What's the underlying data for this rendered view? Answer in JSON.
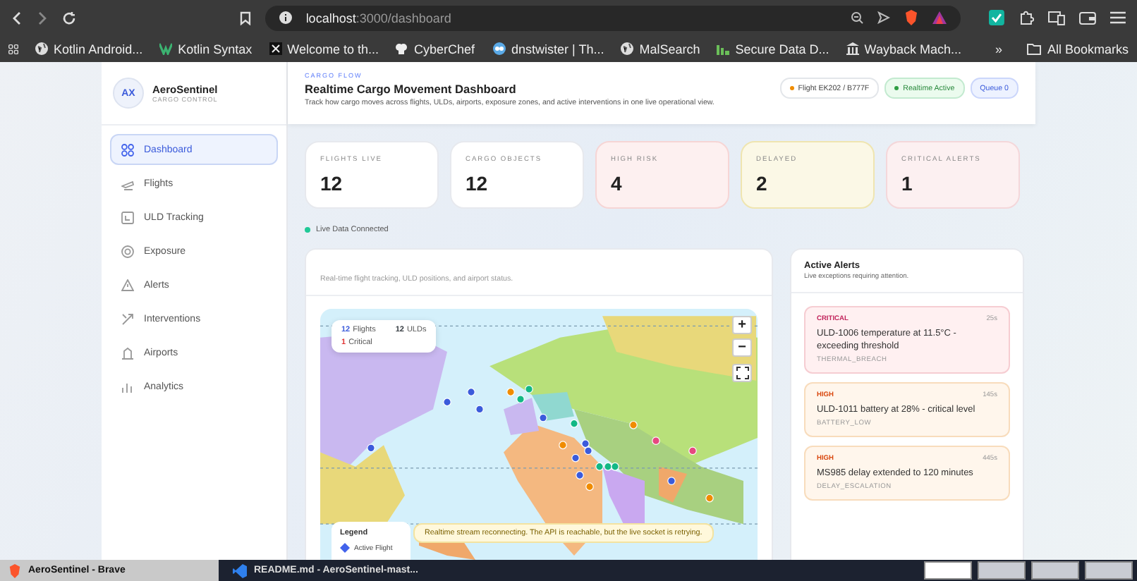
{
  "browser": {
    "url_host": "localhost",
    "url_path": ":3000/dashboard",
    "bookmarks": [
      {
        "label": "Kotlin Android...",
        "kind": "globe"
      },
      {
        "label": "Kotlin Syntax",
        "kind": "k"
      },
      {
        "label": "Welcome to th...",
        "kind": "square"
      },
      {
        "label": "CyberChef",
        "kind": "chef"
      },
      {
        "label": "dnstwister | Th...",
        "kind": "ring"
      },
      {
        "label": "MalSearch",
        "kind": "globe"
      },
      {
        "label": "Secure Data D...",
        "kind": "bars"
      },
      {
        "label": "Wayback Mach...",
        "kind": "building"
      }
    ],
    "overflow": "»",
    "all_bookmarks": "All Bookmarks"
  },
  "sidebar": {
    "avatar": "AX",
    "brand": "AeroSentinel",
    "subtitle": "CARGO CONTROL",
    "items": [
      {
        "label": "Dashboard",
        "selected": true
      },
      {
        "label": "Flights",
        "selected": false
      },
      {
        "label": "ULD Tracking",
        "selected": false
      },
      {
        "label": "Exposure",
        "selected": false
      },
      {
        "label": "Alerts",
        "selected": false
      },
      {
        "label": "Interventions",
        "selected": false
      },
      {
        "label": "Airports",
        "selected": false
      },
      {
        "label": "Analytics",
        "selected": false
      }
    ]
  },
  "header": {
    "eyebrow": "CARGO FLOW",
    "title": "Realtime Cargo Movement Dashboard",
    "description": "Track how cargo moves across flights, ULDs, airports, exposure zones, and active interventions in one live operational view.",
    "pills": [
      {
        "label": "Flight EK202 / B777F",
        "kind": "flight"
      },
      {
        "label": "Realtime Active",
        "kind": "active"
      },
      {
        "label": "Queue 0",
        "kind": "queue"
      }
    ]
  },
  "stats": [
    {
      "label": "FLIGHTS LIVE",
      "value": "12",
      "kind": "plain"
    },
    {
      "label": "CARGO OBJECTS",
      "value": "12",
      "kind": "plain"
    },
    {
      "label": "HIGH RISK",
      "value": "4",
      "kind": "risk"
    },
    {
      "label": "DELAYED",
      "value": "2",
      "kind": "delayed"
    },
    {
      "label": "CRITICAL ALERTS",
      "value": "1",
      "kind": "critical"
    }
  ],
  "connection": "Live Data Connected",
  "map_card": {
    "subtitle": "Real-time flight tracking, ULD positions, and airport status.",
    "counts": [
      {
        "value": "12",
        "label": "Flights",
        "color": "#3b5bdb"
      },
      {
        "value": "12",
        "label": "ULDs",
        "color": "#343a40"
      },
      {
        "value": "1",
        "label": "Critical",
        "color": "#e03131"
      }
    ],
    "zoom_in": "+",
    "zoom_out": "−",
    "legend_title": "Legend",
    "legend_items": [
      "Active Flight"
    ],
    "banner": "Realtime stream reconnecting. The API is reachable, but the live socket is retrying."
  },
  "alerts": {
    "title": "Active Alerts",
    "subtitle": "Live exceptions requiring attention.",
    "items": [
      {
        "severity": "CRITICAL",
        "time": "25s",
        "message": "ULD-1006 temperature at 11.5°C - exceeding threshold",
        "code": "THERMAL_BREACH",
        "kind": "critical"
      },
      {
        "severity": "HIGH",
        "time": "145s",
        "message": "ULD-1011 battery at 28% - critical level",
        "code": "BATTERY_LOW",
        "kind": "high"
      },
      {
        "severity": "HIGH",
        "time": "445s",
        "message": "MS985 delay extended to 120 minutes",
        "code": "DELAY_ESCALATION",
        "kind": "high"
      }
    ]
  },
  "taskbar": {
    "tasks": [
      {
        "label": "AeroSentinel - Brave",
        "kind": "brave",
        "selected": true
      },
      {
        "label": "README.md - AeroSentinel-mast...",
        "kind": "code",
        "selected": false
      }
    ],
    "workspaces": [
      {
        "selected": true
      },
      {
        "selected": false
      },
      {
        "selected": false
      },
      {
        "selected": false
      }
    ]
  }
}
